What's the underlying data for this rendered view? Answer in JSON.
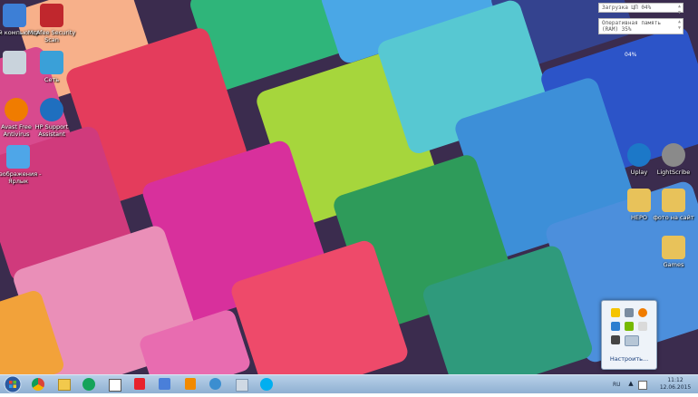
{
  "desktop_icons": [
    {
      "label": "Мой компьютер",
      "icon": "computer-icon",
      "color": "#3d7fd6"
    },
    {
      "label": "McAfee Security Scan",
      "icon": "mcafee-icon",
      "color": "#c0272d"
    },
    {
      "label": "",
      "icon": "recycle-bin-icon",
      "color": "#c9d3dc"
    },
    {
      "label": "Сеть",
      "icon": "network-icon",
      "color": "#3aa0d8"
    },
    {
      "label": "Avast Free Antivirus",
      "icon": "avast-icon",
      "color": "#f07c00"
    },
    {
      "label": "HP Support Assistant",
      "icon": "hp-support-icon",
      "color": "#1f6fbf"
    },
    {
      "label": "Изображения - Ярлык",
      "icon": "pictures-shortcut-icon",
      "color": "#4ea6e8"
    },
    {
      "label": "Uplay",
      "icon": "uplay-icon",
      "color": "#1c78c8"
    },
    {
      "label": "LightScribe",
      "icon": "lightscribe-icon",
      "color": "#8a8a8a"
    },
    {
      "label": "НЕРО",
      "icon": "folder-icon",
      "color": "#e8c25a"
    },
    {
      "label": "фото на сайт",
      "icon": "folder-icon",
      "color": "#e8c25a"
    },
    {
      "label": "Games",
      "icon": "folder-icon",
      "color": "#e8c25a"
    }
  ],
  "gadget": {
    "cpu_label": "Загрузка ЦП 04%",
    "ram_label": "Оперативная память (RAM) 35%",
    "percent_readout": "04%"
  },
  "tray_popup": {
    "customize_label": "Настроить...",
    "icons": [
      {
        "icon": "warning-icon",
        "color": "#f5c400"
      },
      {
        "icon": "volume-icon",
        "color": "#7a8ca0"
      },
      {
        "icon": "avast-tray-icon",
        "color": "#f07c00"
      },
      {
        "icon": "display-icon",
        "color": "#2d7fd0"
      },
      {
        "icon": "nvidia-icon",
        "color": "#76b900"
      },
      {
        "icon": "action-center-flag-icon",
        "color": "#dadada"
      },
      {
        "icon": "hardware-icon",
        "color": "#444444"
      },
      {
        "icon": "network-tray-icon",
        "color": "#b6c6d6"
      }
    ]
  },
  "taskbar": {
    "pinned": [
      {
        "icon": "chrome-icon",
        "color": "#db4437"
      },
      {
        "icon": "explorer-icon",
        "color": "#f2c94c"
      },
      {
        "icon": "mail-agent-icon",
        "color": "#14a35a"
      },
      {
        "icon": "window-app-icon",
        "color": "#ffffff"
      },
      {
        "icon": "yandex-icon",
        "color": "#e8232d"
      },
      {
        "icon": "google-icon",
        "color": "#4a7fd9"
      },
      {
        "icon": "odnoklassniki-icon",
        "color": "#f28a00"
      },
      {
        "icon": "media-icon",
        "color": "#3b8ed0"
      },
      {
        "icon": "speaker-app-icon",
        "color": "#cfd9e4"
      },
      {
        "icon": "skype-icon",
        "color": "#00aff0"
      }
    ],
    "language": "RU",
    "time": "11:12",
    "date": "12.06.2015"
  },
  "colors": {
    "taskbar": "#9bbad9",
    "accent": "#1a3e7a"
  }
}
